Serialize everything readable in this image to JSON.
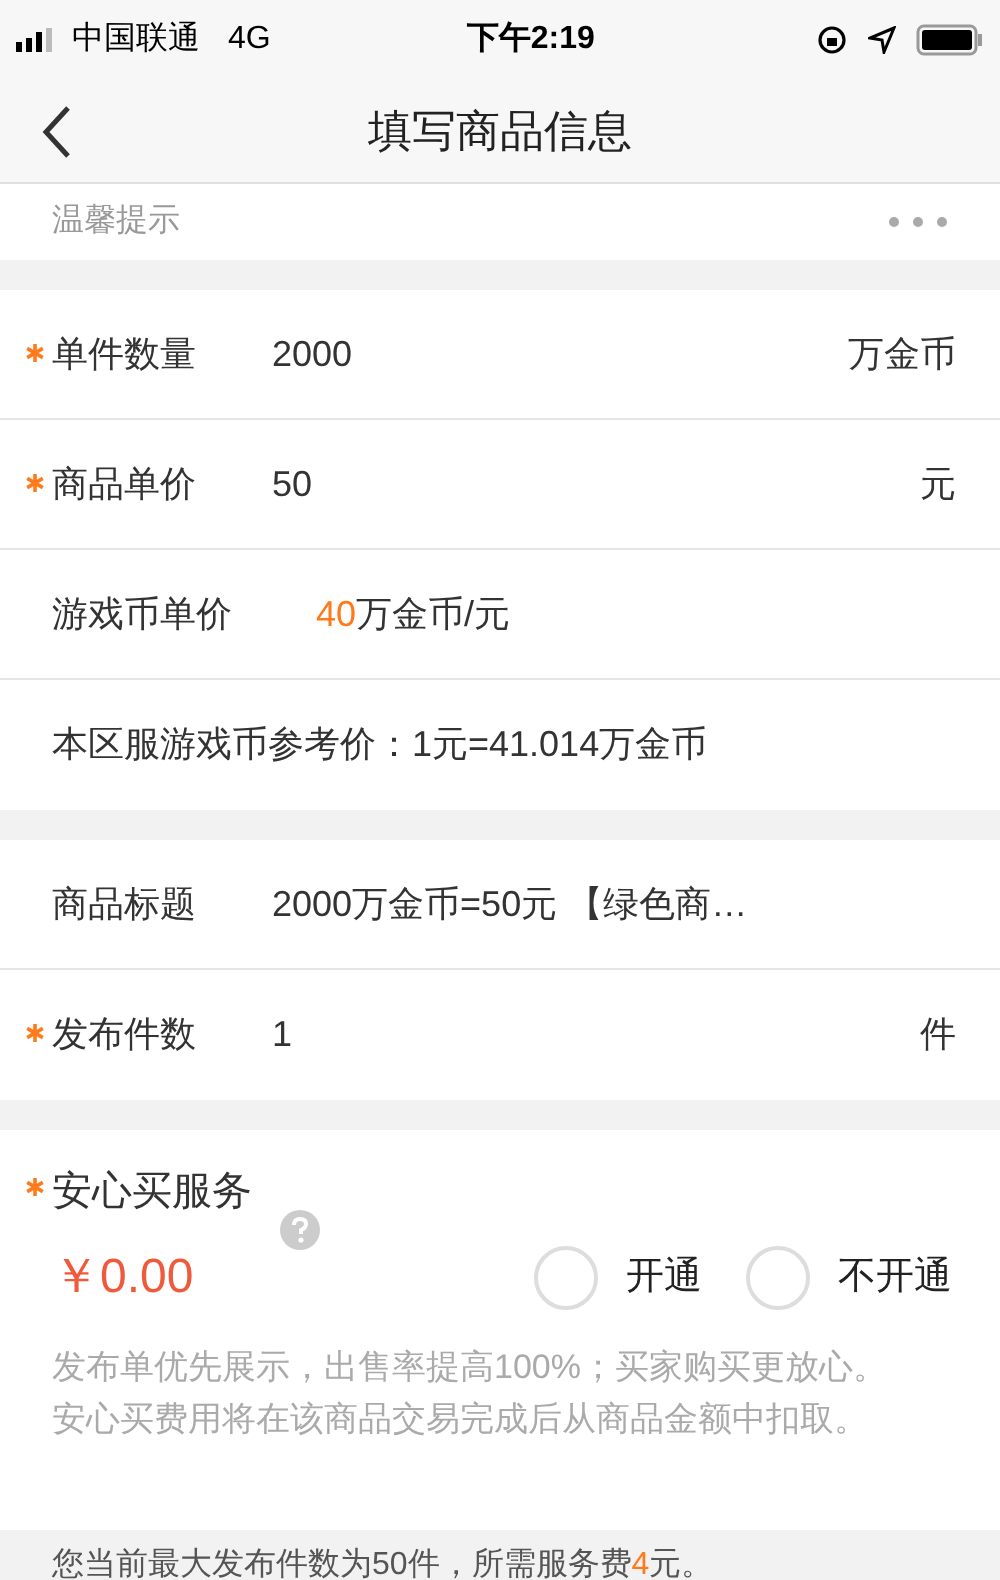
{
  "status_bar": {
    "carrier": "中国联通",
    "network": "4G",
    "time": "下午2:19"
  },
  "nav": {
    "title": "填写商品信息"
  },
  "tip": {
    "label": "温馨提示"
  },
  "group_1": [
    {
      "kind": "field",
      "required": true,
      "label": "单件数量",
      "value": "2000",
      "unit": "万金币"
    },
    {
      "kind": "field",
      "required": true,
      "label": "商品单价",
      "value": "50",
      "unit": "元"
    },
    {
      "kind": "rate",
      "required": false,
      "label": "游戏币单价",
      "value": "40",
      "unit": "万金币/元"
    },
    {
      "kind": "note",
      "required": false,
      "label": "本区服游戏币参考价：1元=41.014万金币"
    }
  ],
  "group_2": [
    {
      "kind": "field",
      "required": false,
      "label": "商品标题",
      "value": "2000万金币=50元 【绿色商…"
    },
    {
      "kind": "field",
      "required": true,
      "label": "发布件数",
      "value": "1",
      "unit": "件"
    }
  ],
  "service": {
    "required": true,
    "title": "安心买服务",
    "price": "￥0.00",
    "options": [
      {
        "label": "开通",
        "selected": false
      },
      {
        "label": "不开通",
        "selected": false
      }
    ],
    "description": "发布单优先展示，出售率提高100%；买家购买更放心。安心买费用将在该商品交易完成后从商品金额中扣取。"
  },
  "notice": {
    "before": "您当前最大发布件数为50件，所需服务费",
    "amount": "4",
    "after": "元。"
  }
}
